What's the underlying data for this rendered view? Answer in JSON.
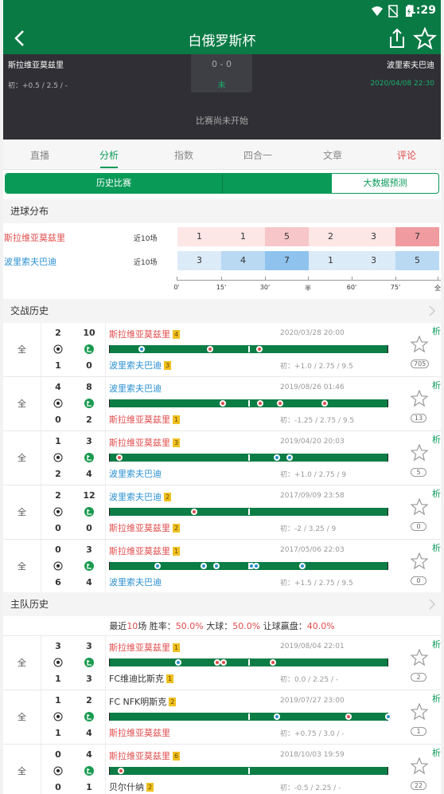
{
  "status_bar": {
    "time": "1:29"
  },
  "header": {
    "title": "白俄罗斯杯"
  },
  "match": {
    "home": "斯拉维亚莫兹里",
    "away": "波里索夫巴迪",
    "score": "0 - 0",
    "state": "未",
    "odds": "初：+0.5 / 2.5 / -",
    "datetime": "2020/04/08 22:30",
    "not_started": "比赛尚未开始"
  },
  "tabs": [
    {
      "label": "直播"
    },
    {
      "label": "分析"
    },
    {
      "label": "指数"
    },
    {
      "label": "四合一"
    },
    {
      "label": "文章"
    },
    {
      "label": "评论"
    }
  ],
  "segment": {
    "left": "历史比赛",
    "right": "大数据预测"
  },
  "goal_dist": {
    "title": "进球分布",
    "rows": [
      {
        "team": "斯拉维亚莫兹里",
        "range": "近10场",
        "values": [
          1,
          1,
          5,
          2,
          3,
          7
        ]
      },
      {
        "team": "波里索夫巴迪",
        "range": "近10场",
        "values": [
          3,
          4,
          7,
          1,
          3,
          5
        ]
      }
    ],
    "axis": [
      "0'",
      "15'",
      "30'",
      "半",
      "60'",
      "75'",
      "全"
    ]
  },
  "h2h": {
    "title": "交战历史",
    "rows": [
      {
        "cat": "全",
        "s1a": "2",
        "s1b": "10",
        "s2a": "1",
        "s2b": "0",
        "t1": "斯拉维亚莫兹里",
        "r1": "4",
        "t2": "波里索夫巴迪",
        "r2": "3",
        "date": "2020/03/28 20:00",
        "odds": "初：+1.0 / 2.75 / 9.5",
        "count": "705"
      },
      {
        "cat": "全",
        "s1a": "4",
        "s1b": "8",
        "s2a": "0",
        "s2b": "2",
        "t1": "波里索夫巴迪",
        "r1": "",
        "t2": "斯拉维亚莫兹里",
        "r2": "1",
        "date": "2019/08/26 01:46",
        "odds": "初：-1.25 / 2.75 / 9.5",
        "count": "13"
      },
      {
        "cat": "全",
        "s1a": "1",
        "s1b": "3",
        "s2a": "2",
        "s2b": "4",
        "t1": "斯拉维亚莫兹里",
        "r1": "3",
        "t2": "波里索夫巴迪",
        "r2": "",
        "date": "2019/04/20 20:03",
        "odds": "初：+1.0 / 2.75 / 9",
        "count": "5"
      },
      {
        "cat": "全",
        "s1a": "2",
        "s1b": "12",
        "s2a": "0",
        "s2b": "0",
        "t1": "波里索夫巴迪",
        "r1": "2",
        "t2": "斯拉维亚莫兹里",
        "r2": "2",
        "date": "2017/09/09 23:58",
        "odds": "初：-2 / 3.25 / 9",
        "count": "0"
      },
      {
        "cat": "全",
        "s1a": "0",
        "s1b": "3",
        "s2a": "6",
        "s2b": "4",
        "t1": "斯拉维亚莫兹里",
        "r1": "1",
        "t2": "波里索夫巴迪",
        "r2": "",
        "date": "2017/05/06 22:03",
        "odds": "初：+1.5 / 2.75 / 9.5",
        "count": "0"
      }
    ]
  },
  "home_hist": {
    "title": "主队历史",
    "summary": {
      "prefix": "最近",
      "n": "10",
      "mid1": "场 胜率：",
      "win": "50.0%",
      "mid2": " 大球：",
      "big": "50.0%",
      "mid3": " 让球赢盘：",
      "hcp": "40.0%"
    },
    "rows": [
      {
        "cat": "全",
        "s1a": "3",
        "s1b": "3",
        "s2a": "1",
        "s2b": "3",
        "t1": "斯拉维亚莫兹里",
        "r1": "1",
        "t2": "FC维迪比斯克",
        "r2": "1",
        "date": "2019/08/04 22:01",
        "odds": "初：0.0 / 2.25 / -",
        "count": "2"
      },
      {
        "cat": "全",
        "s1a": "1",
        "s1b": "2",
        "s2a": "1",
        "s2b": "4",
        "t1": "FC NFK明斯克",
        "r1": "2",
        "t2": "斯拉维亚莫兹里",
        "r2": "",
        "date": "2019/07/27 23:00",
        "odds": "初：+0.75 / 3.0 / -",
        "count": "1"
      },
      {
        "cat": "全",
        "s1a": "0",
        "s1b": "4",
        "s2a": "0",
        "s2b": "1",
        "t1": "斯拉维亚莫兹里",
        "r1": "6",
        "t2": "贝尔什纳",
        "r2": "2",
        "date": "2018/10/03 19:59",
        "odds": "初：-0.5 / 2.25 / -",
        "count": "22"
      }
    ]
  },
  "side_label": "析",
  "colors": {
    "green": "#0a7a45",
    "accent": "#0a9a58",
    "red": "#e14b4b",
    "blue": "#2a8fd0"
  }
}
